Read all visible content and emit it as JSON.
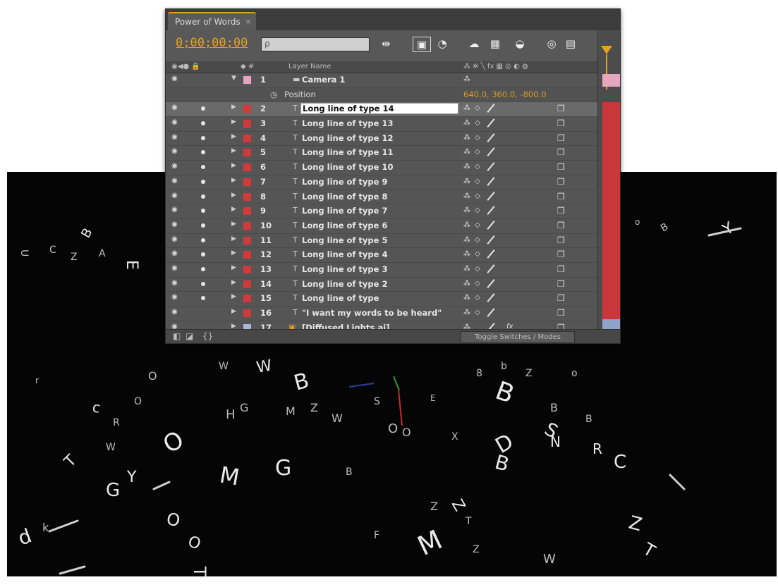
{
  "panel": {
    "tab_title": "Power of Words",
    "tab_close": "×",
    "timecode": "0;00;00;00",
    "search_placeholder": "ρ"
  },
  "column_headers": {
    "source_name": "Layer Name",
    "switches": "⁂ ✲ ╲ fx ▦ ◎ ◐ ◍"
  },
  "layers": [
    {
      "num": "1",
      "name": "Camera 1",
      "color": "#e7a6be",
      "type": "camera",
      "expanded": true
    },
    {
      "num": "2",
      "name": "Long line of type 14",
      "color": "#d23a3a",
      "type": "text",
      "editing": true
    },
    {
      "num": "3",
      "name": "Long line of type 13",
      "color": "#d23a3a",
      "type": "text"
    },
    {
      "num": "4",
      "name": "Long line of type 12",
      "color": "#d23a3a",
      "type": "text"
    },
    {
      "num": "5",
      "name": "Long line of type 11",
      "color": "#d23a3a",
      "type": "text"
    },
    {
      "num": "6",
      "name": "Long line of type 10",
      "color": "#d23a3a",
      "type": "text"
    },
    {
      "num": "7",
      "name": "Long line of type 9",
      "color": "#d23a3a",
      "type": "text"
    },
    {
      "num": "8",
      "name": "Long line of type 8",
      "color": "#d23a3a",
      "type": "text"
    },
    {
      "num": "9",
      "name": "Long line of type 7",
      "color": "#d23a3a",
      "type": "text"
    },
    {
      "num": "10",
      "name": "Long line of type 6",
      "color": "#d23a3a",
      "type": "text"
    },
    {
      "num": "11",
      "name": "Long line of type 5",
      "color": "#d23a3a",
      "type": "text"
    },
    {
      "num": "12",
      "name": "Long line of type 4",
      "color": "#d23a3a",
      "type": "text"
    },
    {
      "num": "13",
      "name": "Long line of type 3",
      "color": "#d23a3a",
      "type": "text"
    },
    {
      "num": "14",
      "name": "Long line of type 2",
      "color": "#d23a3a",
      "type": "text"
    },
    {
      "num": "15",
      "name": "Long line of type",
      "color": "#d23a3a",
      "type": "text"
    },
    {
      "num": "16",
      "name": "\"I want my words to be heard\"",
      "color": "#d23a3a",
      "type": "text"
    },
    {
      "num": "17",
      "name": "[Diffused Lights.ai]",
      "color": "#a9b8d6",
      "type": "footage"
    }
  ],
  "camera_property": {
    "label": "Position",
    "value": "640.0, 360.0, -800.0"
  },
  "footer": {
    "toggle_label": "Toggle Switches / Modes"
  },
  "colors": {
    "accent": "#e6a21a",
    "text_label": "#d23a3a",
    "camera_label": "#e7a6be",
    "footage_label": "#a9b8d6"
  }
}
